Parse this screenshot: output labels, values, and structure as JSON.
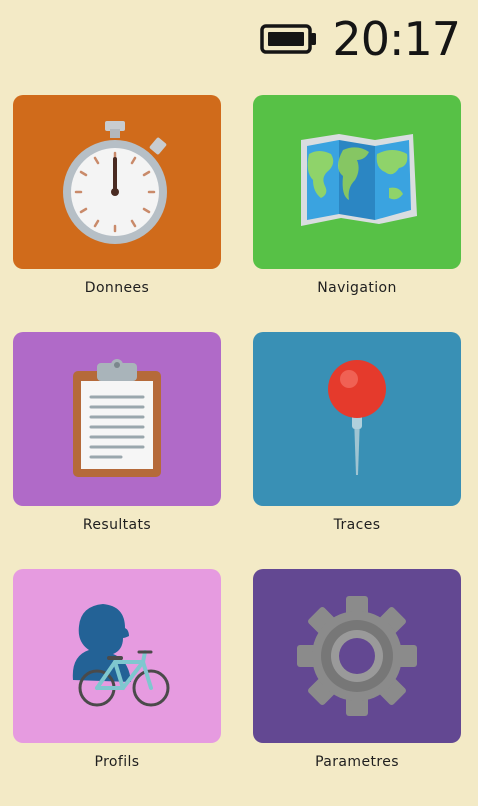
{
  "status": {
    "time": "20:17",
    "battery_icon": "battery-full-icon"
  },
  "tiles": [
    {
      "label": "Donnees",
      "color": "#d06b1b",
      "icon": "stopwatch-icon"
    },
    {
      "label": "Navigation",
      "color": "#57c146",
      "icon": "world-map-icon"
    },
    {
      "label": "Resultats",
      "color": "#b06ac8",
      "icon": "clipboard-icon"
    },
    {
      "label": "Traces",
      "color": "#3990b5",
      "icon": "pushpin-icon"
    },
    {
      "label": "Profils",
      "color": "#e69be0",
      "icon": "cyclist-profile-icon"
    },
    {
      "label": "Parametres",
      "color": "#634892",
      "icon": "gear-icon"
    }
  ]
}
